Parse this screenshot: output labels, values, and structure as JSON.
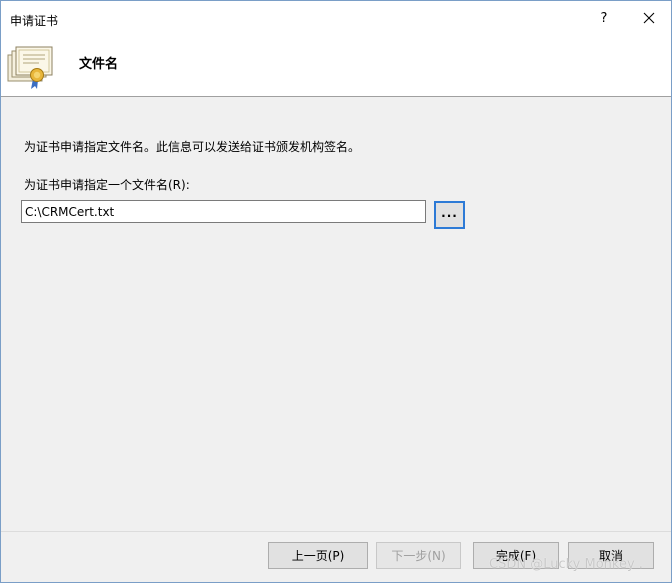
{
  "window": {
    "title": "申请证书",
    "help_label": "?",
    "close_icon": "close-icon"
  },
  "header": {
    "icon": "certificate-icon",
    "title": "文件名"
  },
  "content": {
    "description": "为证书申请指定文件名。此信息可以发送给证书颁发机构签名。",
    "field_label": "为证书申请指定一个文件名(R):",
    "filename_value": "C:\\CRMCert.txt",
    "browse_label": "..."
  },
  "footer": {
    "back_label": "上一页(P)",
    "next_label": "下一步(N)",
    "finish_label": "完成(F)",
    "cancel_label": "取消"
  },
  "watermark": "CSDN @Lucky Monkey .",
  "colors": {
    "focus_border": "#2d7ad6",
    "dialog_bg": "#f0f0f0",
    "header_bg": "#ffffff"
  }
}
